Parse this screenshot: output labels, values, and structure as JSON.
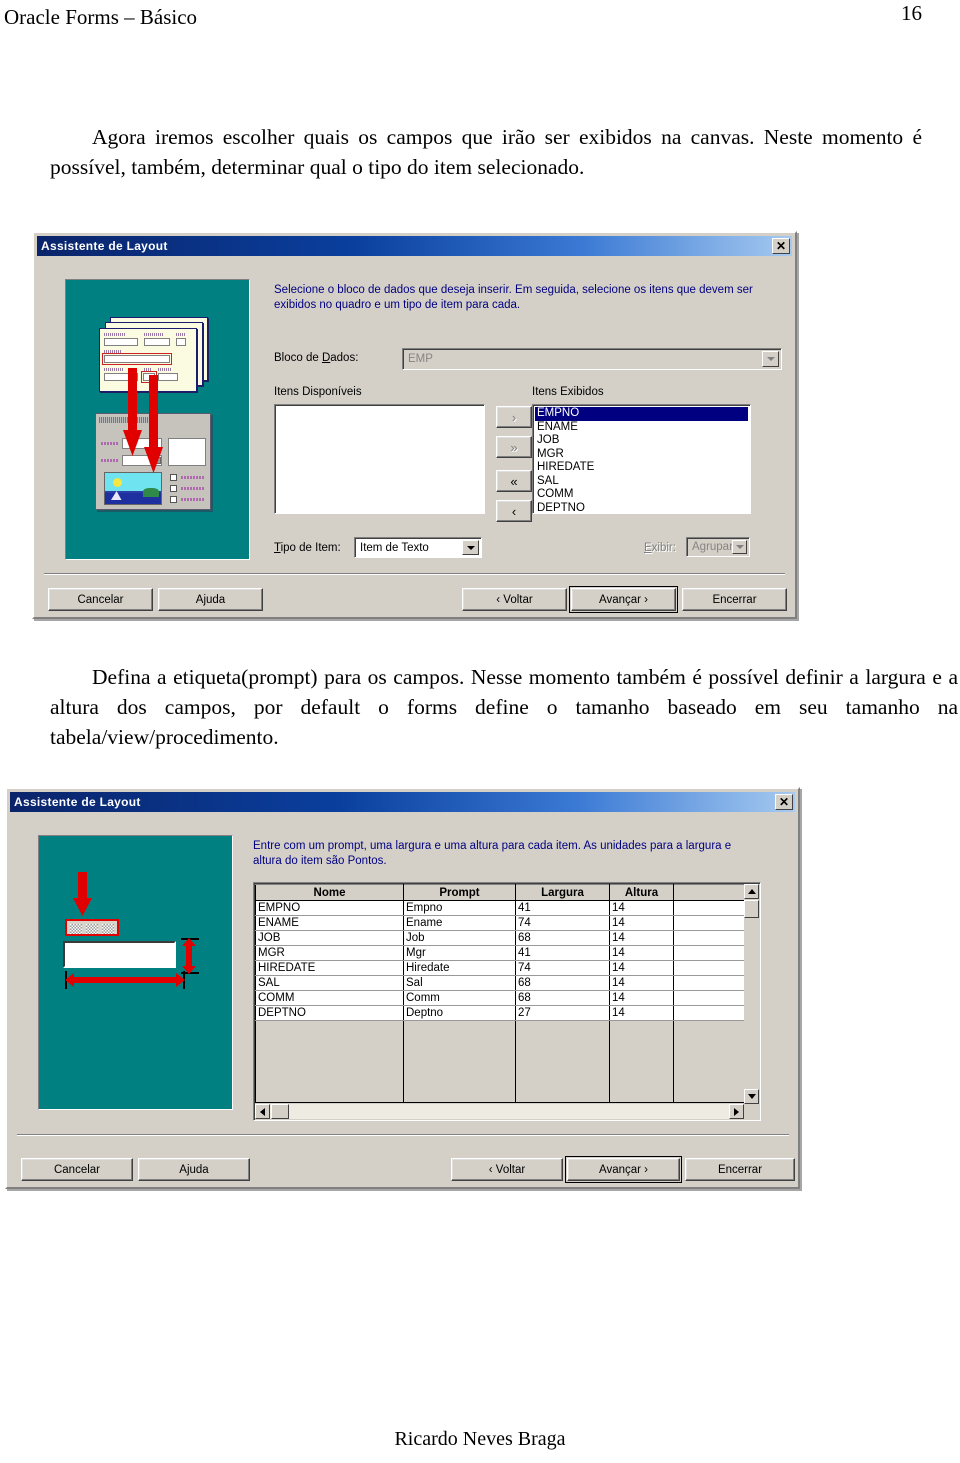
{
  "header": {
    "doc_title": "Oracle Forms – Básico",
    "page_number": "16"
  },
  "paragraphs": {
    "p1": "Agora iremos escolher quais os campos que irão ser exibidos na canvas. Neste momento é possível, também, determinar qual o tipo do item selecionado.",
    "p2": "Defina a etiqueta(prompt) para os campos. Nesse momento também é possível definir a largura e a altura dos campos, por default o forms define o tamanho baseado em seu tamanho na tabela/view/procedimento."
  },
  "footer": {
    "author": "Ricardo Neves Braga"
  },
  "dialog1": {
    "title": "Assistente de Layout",
    "close_label": "✕",
    "description": "Selecione o bloco de dados que deseja inserir. Em seguida, selecione os itens que devem ser exibidos no quadro e um tipo de item para cada.",
    "block_label": "Bloco de Dados:",
    "block_value": "EMP",
    "available_label": "Itens Disponíveis",
    "available_items": [],
    "displayed_label": "Itens Exibidos",
    "displayed_items": [
      "EMPNO",
      "ENAME",
      "JOB",
      "MGR",
      "HIREDATE",
      "SAL",
      "COMM",
      "DEPTNO"
    ],
    "selected_item": "EMPNO",
    "transfer_buttons": [
      {
        "label": "›",
        "name": "move-right-button",
        "disabled": true
      },
      {
        "label": "»",
        "name": "move-all-right-button",
        "disabled": true
      },
      {
        "label": "«",
        "name": "move-all-left-button",
        "disabled": false
      },
      {
        "label": "‹",
        "name": "move-left-button",
        "disabled": false
      }
    ],
    "item_type_label": "Tipo de Item:",
    "item_type_value": "Item de Texto",
    "display_label": "Exibir:",
    "display_value": "Agrupar",
    "buttons": {
      "cancel": "Cancelar",
      "help": "Ajuda",
      "back": "‹ Voltar",
      "next": "Avançar ›",
      "finish": "Encerrar"
    }
  },
  "dialog2": {
    "title": "Assistente de Layout",
    "close_label": "✕",
    "description": "Entre com um prompt, uma largura e uma altura para cada item. As unidades para a largura e altura do item são Pontos.",
    "grid": {
      "columns": [
        "Nome",
        "Prompt",
        "Largura",
        "Altura",
        ""
      ],
      "rows": [
        [
          "EMPNO",
          "Empno",
          "41",
          "14",
          ""
        ],
        [
          "ENAME",
          "Ename",
          "74",
          "14",
          ""
        ],
        [
          "JOB",
          "Job",
          "68",
          "14",
          ""
        ],
        [
          "MGR",
          "Mgr",
          "41",
          "14",
          ""
        ],
        [
          "HIREDATE",
          "Hiredate",
          "74",
          "14",
          ""
        ],
        [
          "SAL",
          "Sal",
          "68",
          "14",
          ""
        ],
        [
          "COMM",
          "Comm",
          "68",
          "14",
          ""
        ],
        [
          "DEPTNO",
          "Deptno",
          "27",
          "14",
          ""
        ]
      ]
    },
    "buttons": {
      "cancel": "Cancelar",
      "help": "Ajuda",
      "back": "‹ Voltar",
      "next": "Avançar ›",
      "finish": "Encerrar"
    }
  },
  "colors": {
    "dialog_face": "#d4d0c8",
    "titlebar_start": "#0a246a",
    "titlebar_end": "#a6caf0",
    "preview_teal": "#008080",
    "selection_blue": "#000080",
    "description_text": "#000080",
    "accent_red": "#e00000"
  }
}
